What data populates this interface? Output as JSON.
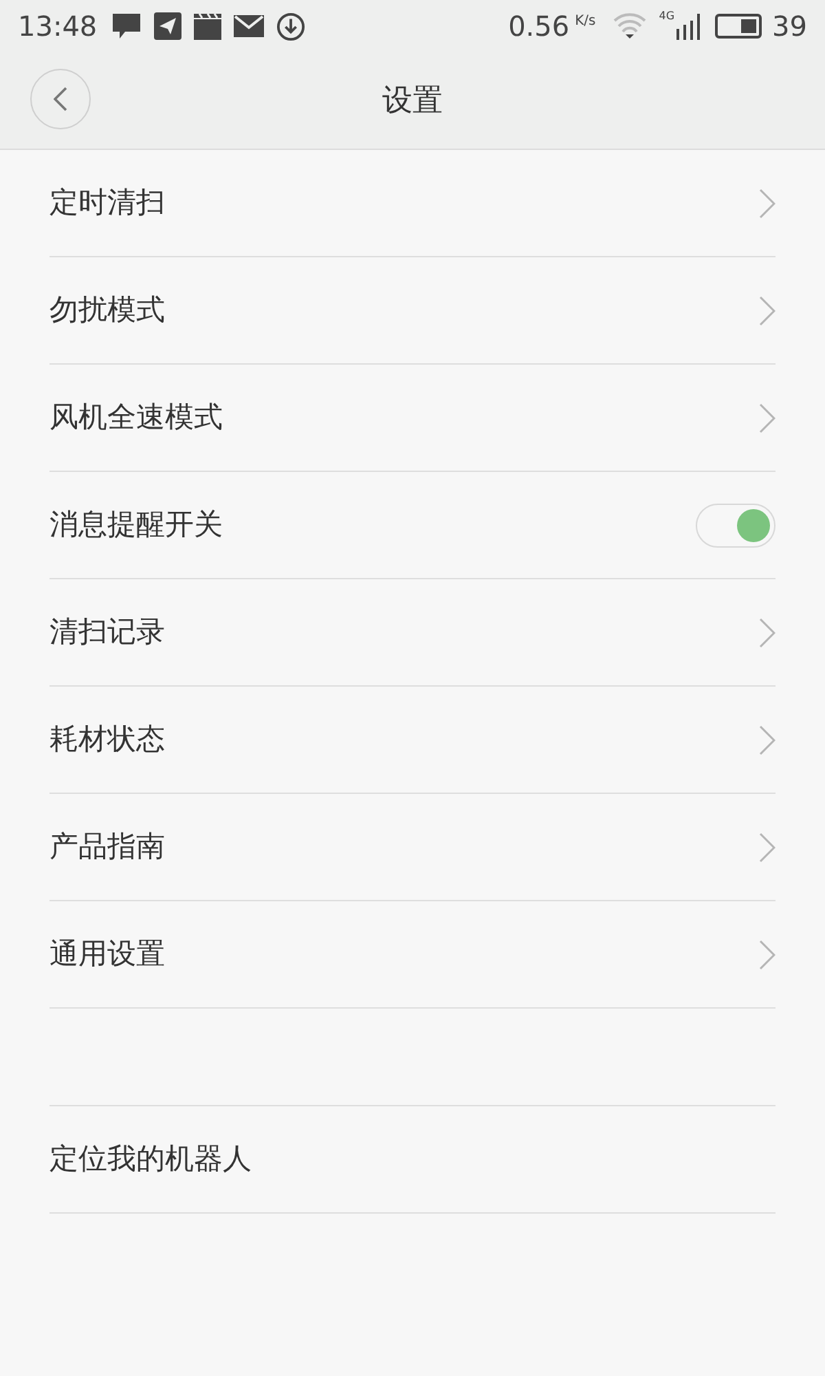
{
  "status_bar": {
    "time": "13:48",
    "speed": "0.56",
    "speed_unit": "K/s",
    "network": "4G",
    "battery": "39"
  },
  "header": {
    "title": "设置"
  },
  "sections": [
    {
      "items": [
        {
          "kind": "link",
          "label": "定时清扫"
        },
        {
          "kind": "link",
          "label": "勿扰模式"
        },
        {
          "kind": "link",
          "label": "风机全速模式"
        },
        {
          "kind": "toggle",
          "label": "消息提醒开关",
          "on": true
        },
        {
          "kind": "link",
          "label": "清扫记录"
        },
        {
          "kind": "link",
          "label": "耗材状态"
        },
        {
          "kind": "link",
          "label": "产品指南"
        },
        {
          "kind": "link",
          "label": "通用设置"
        }
      ]
    },
    {
      "items": [
        {
          "kind": "plain",
          "label": "定位我的机器人"
        }
      ]
    }
  ]
}
